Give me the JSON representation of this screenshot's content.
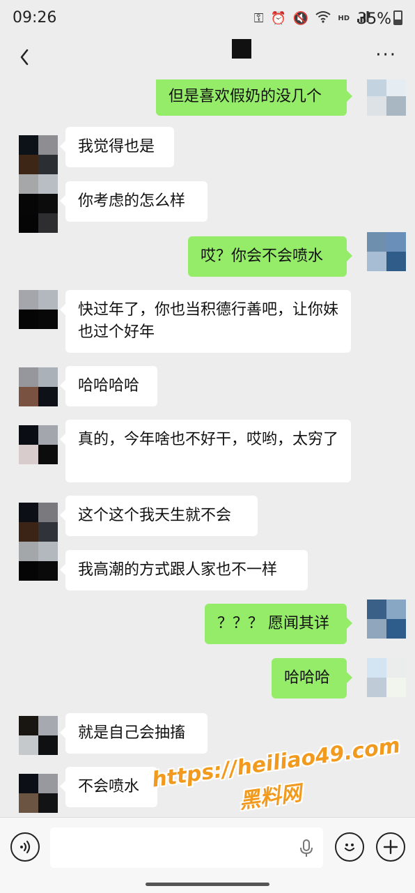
{
  "status_bar": {
    "time": "09:26",
    "battery": "35%",
    "icons": [
      "key-icon",
      "alarm-icon",
      "mute-icon",
      "wifi-icon",
      "hd-icon",
      "signal-icon"
    ],
    "hd_label": "HD"
  },
  "header": {
    "back_icon": "chevron-left-icon",
    "more_icon": "more-icon",
    "more_label": "···"
  },
  "messages": [
    {
      "side": "out",
      "text": "但是喜欢假奶的没几个"
    },
    {
      "side": "in",
      "text": "我觉得也是"
    },
    {
      "side": "in",
      "text": "你考虑的怎么样"
    },
    {
      "side": "out",
      "text": "哎？你会不会喷水"
    },
    {
      "side": "in",
      "text": "快过年了，你也当积德行善吧，让你妹也过个好年"
    },
    {
      "side": "in",
      "text": "哈哈哈哈"
    },
    {
      "side": "in",
      "text": "真的，今年啥也不好干，哎哟，太穷了"
    },
    {
      "side": "in",
      "text": "这个这个我天生就不会"
    },
    {
      "side": "in",
      "text": "我高潮的方式跟人家也不一样"
    },
    {
      "side": "out",
      "text": "？？？ 愿闻其详"
    },
    {
      "side": "out",
      "text": "哈哈哈"
    },
    {
      "side": "in",
      "text": "就是自己会抽搐"
    },
    {
      "side": "in",
      "text": "不会喷水"
    }
  ],
  "watermark": {
    "url": "https://heiliao49.com",
    "name": "黑料网"
  },
  "input_bar": {
    "voice_icon": "voice-icon",
    "emoji_icon": "emoji-icon",
    "add_icon": "add-icon",
    "mic_icon": "mic-icon",
    "add_label": "+"
  },
  "colors": {
    "background": "#ededed",
    "outgoing_bubble": "#95ec69",
    "incoming_bubble": "#ffffff",
    "watermark": "#f29a1d"
  }
}
